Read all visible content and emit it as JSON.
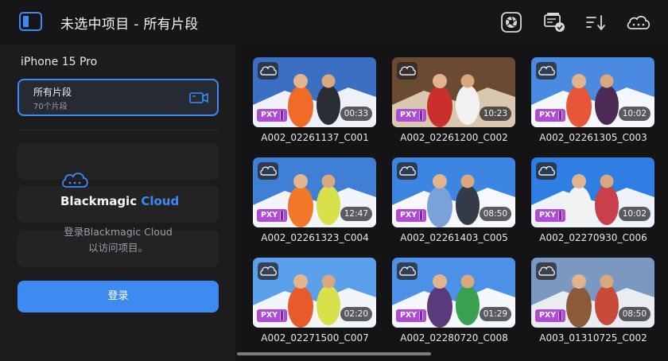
{
  "window": {
    "title": "未选中项目 - 所有片段"
  },
  "toolbar": {
    "icons": [
      "sidebar-toggle-icon",
      "aperture-icon",
      "media-verified-icon",
      "sort-icon",
      "cloud-icon"
    ]
  },
  "sidebar": {
    "device": "iPhone 15 Pro",
    "all_clips": {
      "label": "所有片段",
      "count": "70个片段"
    },
    "cloud": {
      "brand_main": "Blackmagic",
      "brand_accent": "Cloud",
      "hint_line1": "登录Blackmagic Cloud",
      "hint_line2": "以访问项目。",
      "login_label": "登录"
    }
  },
  "clips": [
    {
      "name": "A002_02261137_C001",
      "duration": "00:33",
      "proxy": "PXY"
    },
    {
      "name": "A002_02261200_C002",
      "duration": "10:23",
      "proxy": "PXY"
    },
    {
      "name": "A002_02261305_C003",
      "duration": "10:02",
      "proxy": "PXY"
    },
    {
      "name": "A002_02261323_C004",
      "duration": "12:47",
      "proxy": "PXY"
    },
    {
      "name": "A002_02261403_C005",
      "duration": "08:50",
      "proxy": "PXY"
    },
    {
      "name": "A002_02270930_C006",
      "duration": "10:02",
      "proxy": "PXY"
    },
    {
      "name": "A002_02271500_C007",
      "duration": "02:20",
      "proxy": "PXY"
    },
    {
      "name": "A002_02280720_C008",
      "duration": "01:29",
      "proxy": "PXY"
    },
    {
      "name": "A003_01310725_C002",
      "duration": "08:50",
      "proxy": "PXY"
    }
  ],
  "colors": {
    "accent": "#3d8bf2",
    "proxy_badge": "#b04bd6",
    "background": "#161618",
    "sidebar": "#1c1c1f"
  }
}
